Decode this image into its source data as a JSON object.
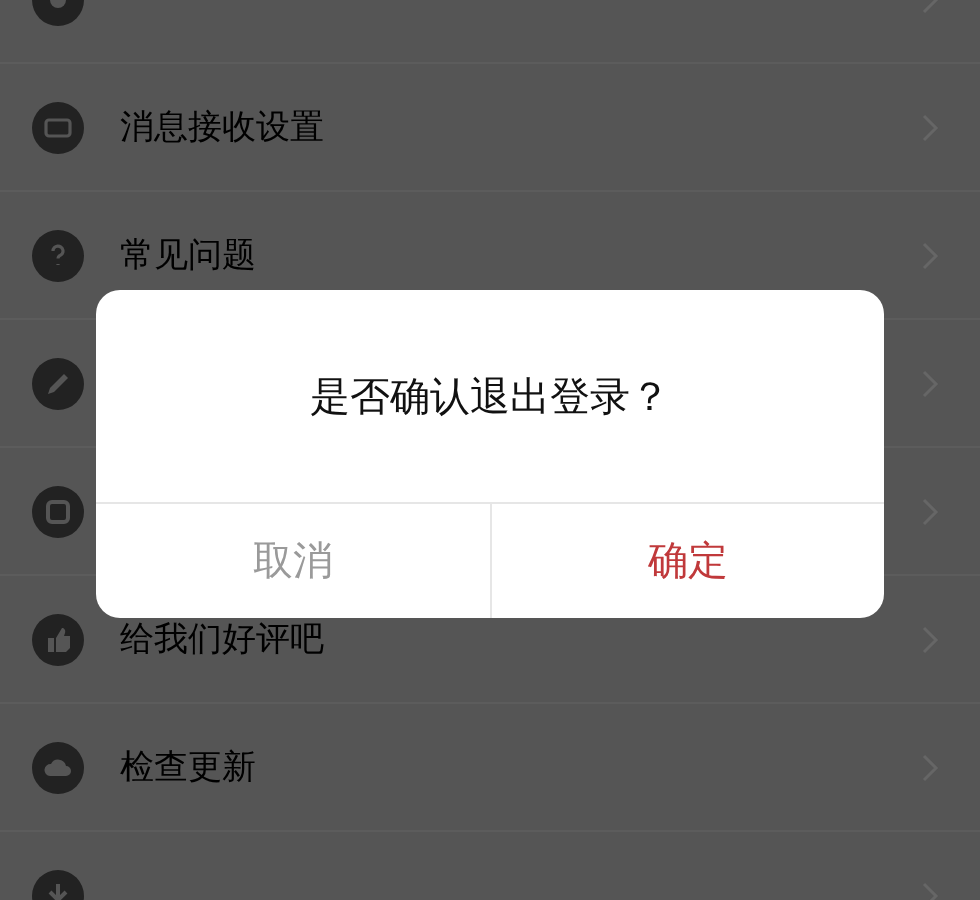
{
  "settings": {
    "rows": [
      {},
      {
        "label": "消息接收设置"
      },
      {
        "label": "常见问题"
      },
      {},
      {},
      {
        "label": "给我们好评吧"
      },
      {
        "label": "检查更新"
      },
      {}
    ]
  },
  "dialog": {
    "message": "是否确认退出登录？",
    "buttons": [
      {
        "label": "取消",
        "kind": "cancel"
      },
      {
        "label": "确定",
        "kind": "confirm"
      }
    ]
  }
}
